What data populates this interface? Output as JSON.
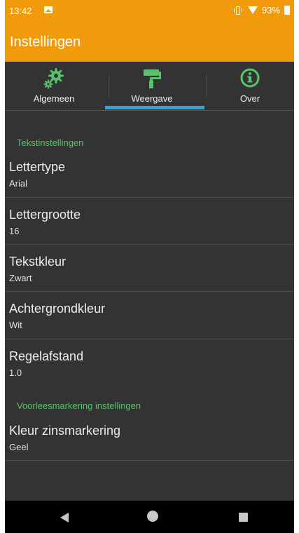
{
  "status_bar": {
    "time": "13:42",
    "battery": "93%"
  },
  "app_bar": {
    "title": "Instellingen"
  },
  "tabs": [
    {
      "label": "Algemeen",
      "icon": "gears-icon",
      "selected": false
    },
    {
      "label": "Weergave",
      "icon": "paint-roller-icon",
      "selected": true
    },
    {
      "label": "Over",
      "icon": "info-icon",
      "selected": false
    }
  ],
  "sections": [
    {
      "header": "Tekstinstellingen",
      "items": [
        {
          "title": "Lettertype",
          "value": "Arial"
        },
        {
          "title": "Lettergrootte",
          "value": "16"
        },
        {
          "title": "Tekstkleur",
          "value": "Zwart"
        },
        {
          "title": "Achtergrondkleur",
          "value": "Wit"
        },
        {
          "title": "Regelafstand",
          "value": "1.0"
        }
      ]
    },
    {
      "header": "Voorleesmarkering instellingen",
      "items": [
        {
          "title": "Kleur zinsmarkering",
          "value": "Geel"
        }
      ]
    }
  ],
  "colors": {
    "accent": "#f19a0c",
    "icon_green": "#56c46a",
    "tab_indicator": "#2fa7d9",
    "background": "#333333"
  }
}
